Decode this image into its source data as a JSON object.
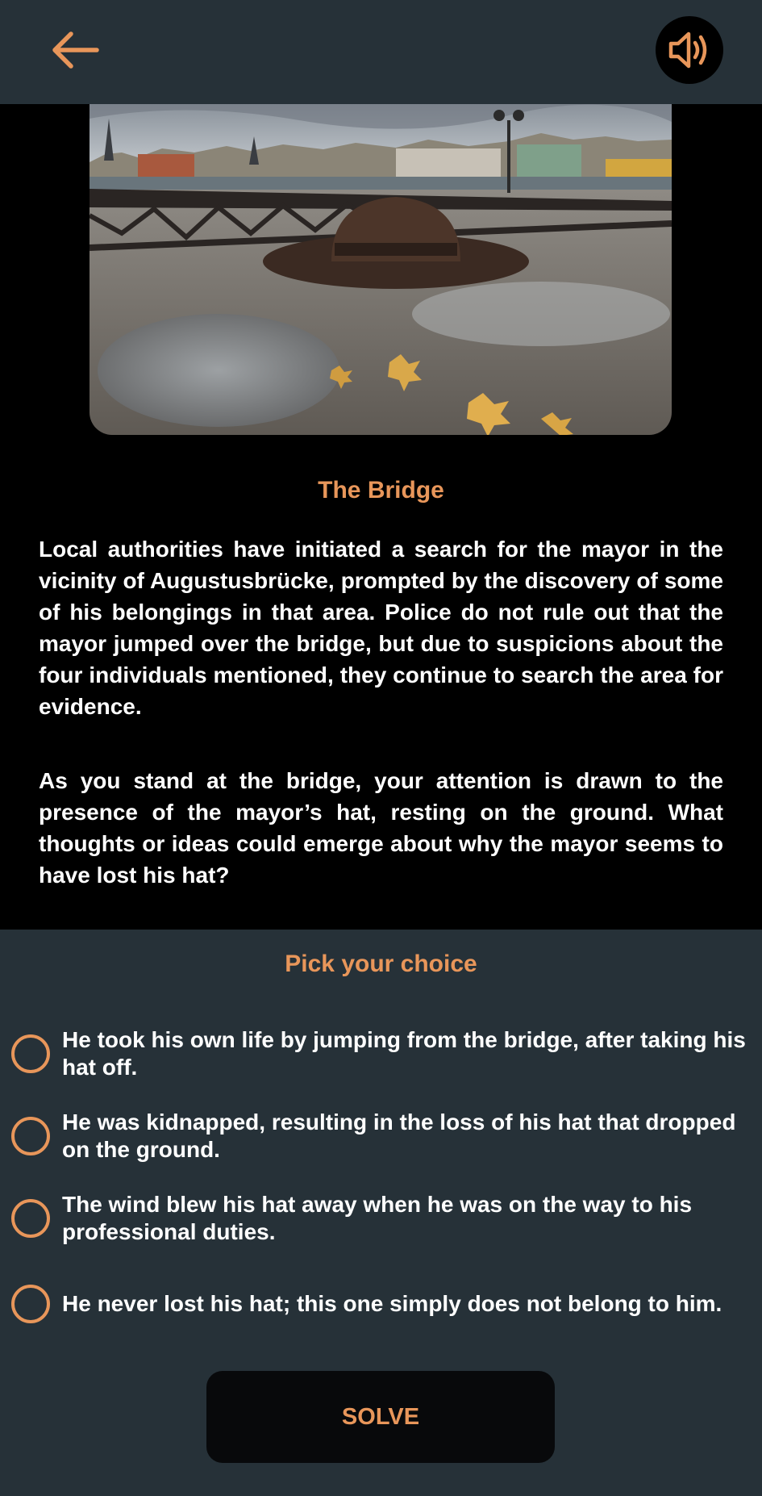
{
  "header": {
    "back_icon": "arrow-left-icon",
    "sound_icon": "speaker-volume-icon",
    "accent_color": "#e8965a"
  },
  "story": {
    "image_subject": "hat-on-bridge-photo",
    "title": "The Bridge",
    "paragraphs": [
      "Local authorities have initiated a search for the mayor in the vicinity of Augustusbrücke, prompted by the discovery of some of his belongings in that area. Police do not rule out that the mayor jumped over the bridge, but due to suspicions about the four individuals mentioned, they continue to search the area for evidence.",
      "As you stand at the bridge, your attention is drawn to the presence of the mayor’s hat, resting on the ground. What thoughts or ideas could emerge about why the mayor seems to have lost his hat?"
    ]
  },
  "choices": {
    "title": "Pick your choice",
    "options": [
      {
        "label": "He took his own life by jumping from the bridge, after taking his hat off."
      },
      {
        "label": "He was kidnapped, resulting in the loss of his hat that dropped on the ground."
      },
      {
        "label": "The wind blew his hat away when he was on the way to his professional duties."
      },
      {
        "label": "He never lost his hat; this one simply does not belong to him."
      }
    ],
    "solve_label": "SOLVE"
  }
}
